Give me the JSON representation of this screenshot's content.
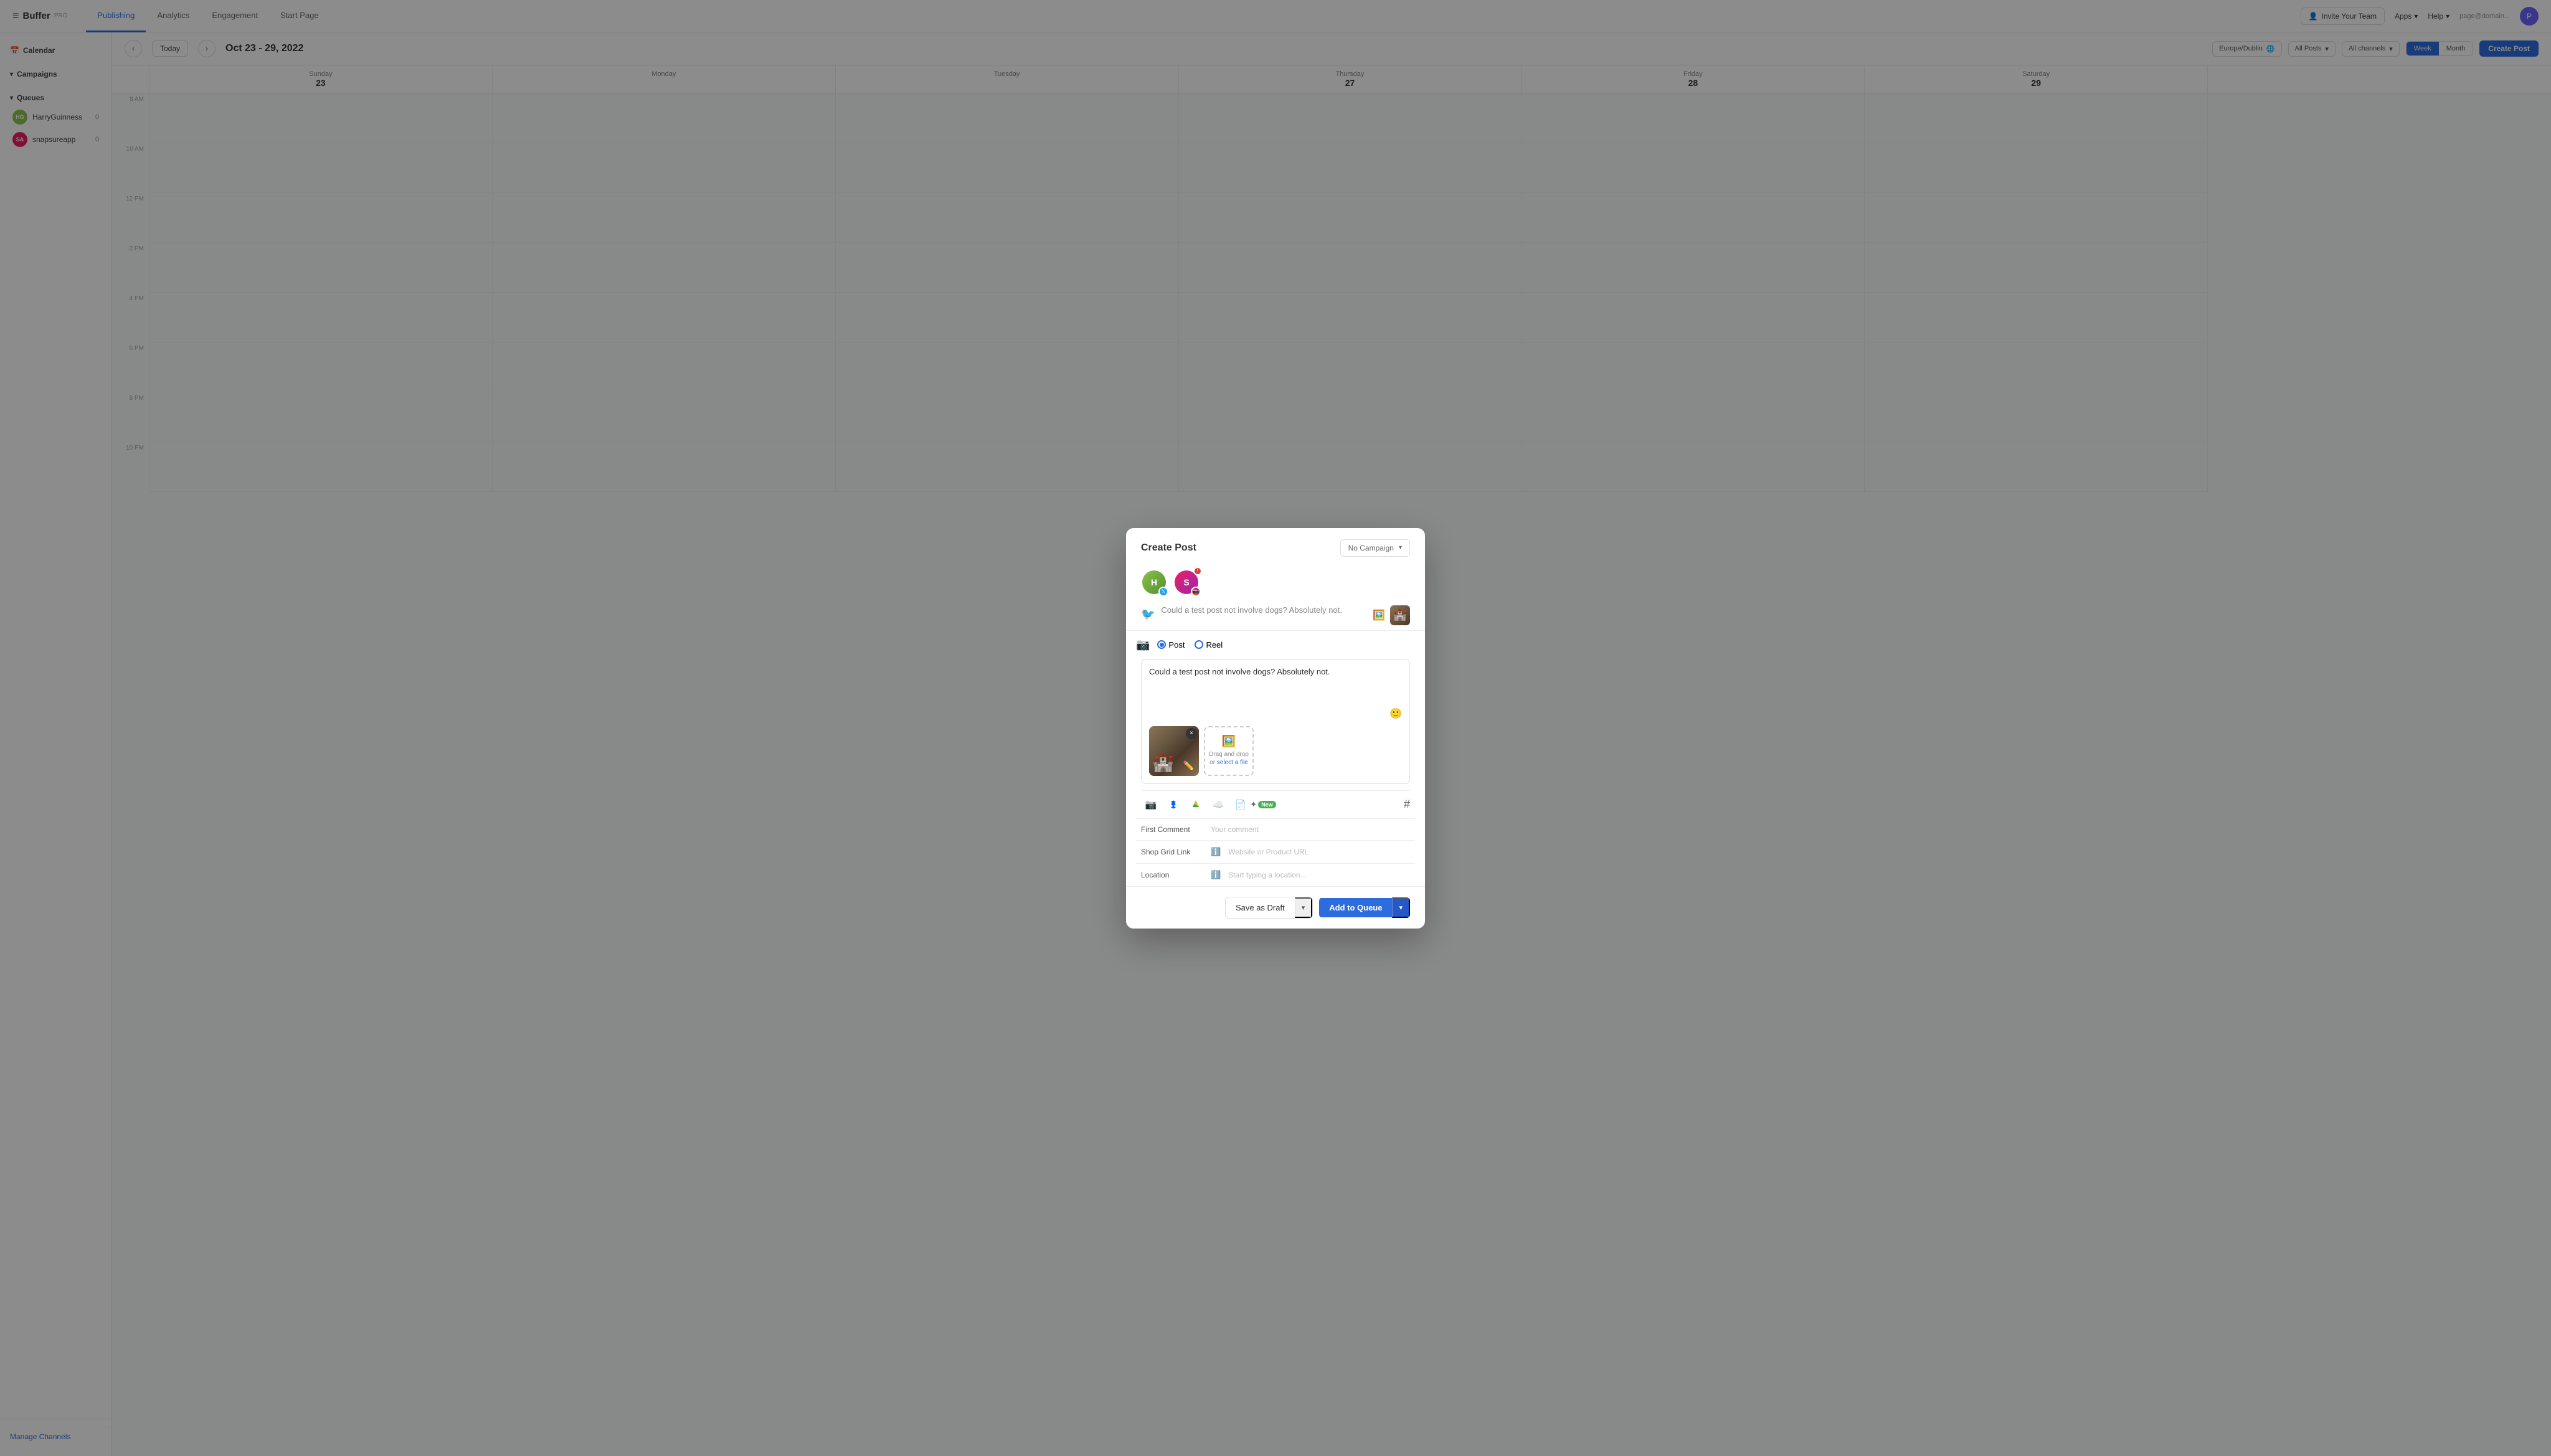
{
  "topnav": {
    "logo": "Buffer",
    "tabs": [
      "Publishing",
      "Analytics",
      "Engagement",
      "Start Page"
    ],
    "active_tab": "Publishing",
    "invite_btn": "Invite Your Team",
    "apps_btn": "Apps",
    "help_btn": "Help",
    "user_email": "page@domain...",
    "avatar_initials": "P"
  },
  "sidebar": {
    "calendar_label": "Calendar",
    "campaigns_label": "Campaigns",
    "queues_label": "Queues",
    "accounts": [
      {
        "name": "HarryGuinness",
        "count": "0",
        "platform": "twitter",
        "color": "#8BC34A"
      },
      {
        "name": "snapsureapp",
        "count": "0",
        "platform": "instagram",
        "color": "#E91E63"
      }
    ],
    "manage_channels": "Manage Channels"
  },
  "calendar": {
    "date_range": "Oct 23 - 29, 2022",
    "today_btn": "Today",
    "timezone": "Europe/Dublin",
    "filter_allposts": "All Posts",
    "filter_allchannels": "All channels",
    "view_week": "Week",
    "view_month": "Month",
    "create_post_btn": "Create Post",
    "days": [
      {
        "name": "Sunday",
        "num": "23"
      },
      {
        "name": "Monday",
        "num": ""
      },
      {
        "name": "Tuesday",
        "num": ""
      },
      {
        "name": "Thursday",
        "num": "27"
      },
      {
        "name": "Friday",
        "num": "28"
      },
      {
        "name": "Saturday",
        "num": "29"
      }
    ],
    "times": [
      "8 AM",
      "10 AM",
      "12 PM",
      "2 PM",
      "4 PM",
      "6 PM",
      "8 PM",
      "10 PM"
    ]
  },
  "modal": {
    "title": "Create Post",
    "campaign_placeholder": "No Campaign",
    "twitter_placeholder": "Could a test post not involve dogs? Absolutely not.",
    "instagram_post_text": "Could a test post not involve dogs? Absolutely not.",
    "post_type_post": "Post",
    "post_type_reel": "Reel",
    "selected_type": "Post",
    "drag_drop_text": "Drag and drop",
    "drag_drop_or": "or",
    "drag_drop_select": "select a file",
    "first_comment_label": "First Comment",
    "first_comment_placeholder": "Your comment",
    "shop_grid_label": "Shop Grid Link",
    "shop_grid_placeholder": "Website or Product URL",
    "location_label": "Location",
    "location_placeholder": "Start typing a location...",
    "save_draft_btn": "Save as Draft",
    "add_queue_btn": "Add to Queue",
    "new_badge": "New"
  }
}
